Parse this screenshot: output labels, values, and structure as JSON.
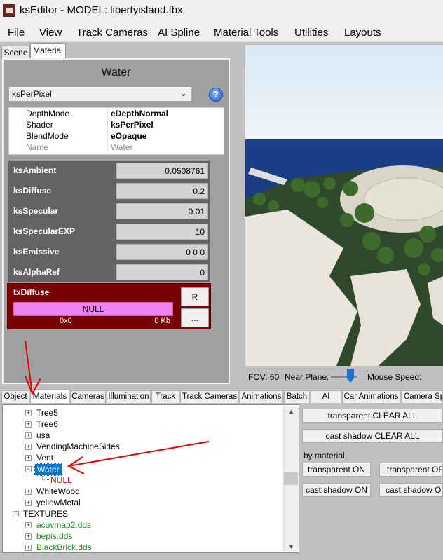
{
  "window": {
    "title": "ksEditor - MODEL: libertyisland.fbx"
  },
  "menu": [
    "File",
    "View",
    "Track Cameras",
    "AI Spline",
    "Material Tools",
    "Utilities",
    "Layouts"
  ],
  "top_tabs": {
    "scene": "Scene",
    "material": "Material"
  },
  "material": {
    "name": "Water",
    "shader_select": "ksPerPixel",
    "help": "?",
    "properties": [
      {
        "key": "DepthMode",
        "value": "eDepthNormal"
      },
      {
        "key": "Shader",
        "value": "ksPerPixel"
      },
      {
        "key": "BlendMode",
        "value": "eOpaque"
      },
      {
        "key": "Name",
        "value": "Water"
      }
    ],
    "vars": [
      {
        "label": "ksAmbient",
        "value": "0.0508761"
      },
      {
        "label": "ksDiffuse",
        "value": "0.2"
      },
      {
        "label": "ksSpecular",
        "value": "0.01"
      },
      {
        "label": "ksSpecularEXP",
        "value": "10"
      },
      {
        "label": "ksEmissive",
        "value": "0 0 0"
      },
      {
        "label": "ksAlphaRef",
        "value": "0"
      }
    ],
    "texture": {
      "label": "txDiffuse",
      "file": "NULL",
      "size": "0x0",
      "kb": "0 Kb",
      "btn_r": "R",
      "btn_more": "..."
    }
  },
  "viewport_bar": {
    "fov": "FOV: 60",
    "near": "Near Plane:",
    "mouse": "Mouse Speed:"
  },
  "bottom_tabs": [
    "Object",
    "Materials",
    "Cameras",
    "Illumination",
    "Track",
    "Track Cameras",
    "Animations",
    "Batch",
    "AI",
    "Car Animations",
    "Camera Spli"
  ],
  "tree": [
    {
      "label": "Tree5",
      "color": "#000000"
    },
    {
      "label": "Tree6",
      "color": "#000000"
    },
    {
      "label": "usa",
      "color": "#000000"
    },
    {
      "label": "VendingMachineSides",
      "color": "#000000"
    },
    {
      "label": "Vent",
      "color": "#000000"
    },
    {
      "label": "Water",
      "color": "#ffffff"
    },
    {
      "label": "NULL",
      "color": "#e00000"
    },
    {
      "label": "WhiteWood",
      "color": "#000000"
    },
    {
      "label": "yellowMetal",
      "color": "#000000"
    },
    {
      "label": "TEXTURES",
      "color": "#000000"
    },
    {
      "label": "acuvmap2.dds",
      "color": "#1a8a1a"
    },
    {
      "label": "bepis.dds",
      "color": "#1a8a1a"
    },
    {
      "label": "BlackBrick.dds",
      "color": "#1a8a1a"
    }
  ],
  "actions": {
    "transparent_clear": "transparent CLEAR ALL",
    "shadow_clear": "cast shadow CLEAR ALL",
    "by_material": "by material",
    "transparent_on": "transparent ON",
    "transparent_off": "transparent OFF",
    "shadow_on": "cast shadow ON",
    "shadow_off": "cast shadow OFF"
  }
}
